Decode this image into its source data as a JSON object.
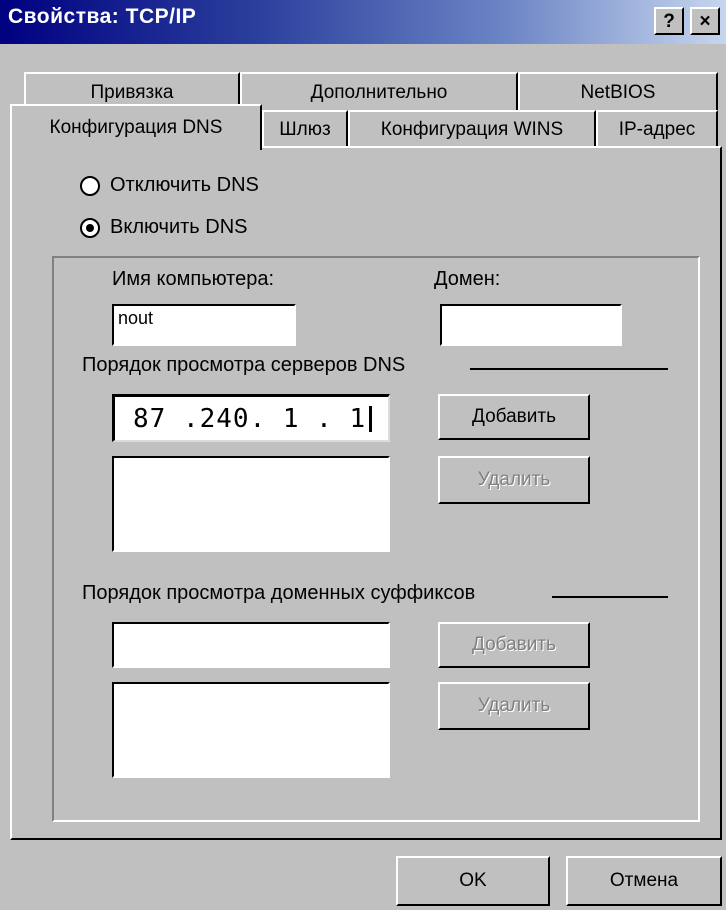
{
  "window": {
    "title": "Свойства: TCP/IP",
    "help_button": "?",
    "close_button": "×"
  },
  "tabs": {
    "row1": [
      "Привязка",
      "Дополнительно",
      "NetBIOS"
    ],
    "row2": [
      "Конфигурация DNS",
      "Шлюз",
      "Конфигурация WINS",
      "IP-адрес"
    ],
    "active": "Конфигурация DNS"
  },
  "dns": {
    "disable_label": "Отключить DNS",
    "enable_label": "Включить DNS",
    "selected": "enable",
    "hostname_label": "Имя компьютера:",
    "hostname_value": "nout",
    "domain_label": "Домен:",
    "domain_value": "",
    "server_order_label": "Порядок просмотра серверов DNS",
    "server_ip_value": "87 .240. 1 . 1",
    "add_server_button": "Добавить",
    "remove_server_button": "Удалить",
    "suffix_order_label": "Порядок просмотра доменных суффиксов",
    "suffix_input_value": "",
    "add_suffix_button": "Добавить",
    "remove_suffix_button": "Удалить"
  },
  "footer": {
    "ok_button": "OK",
    "cancel_button": "Отмена"
  },
  "colors": {
    "face": "#c0c0c0",
    "titlebar_start": "#000080",
    "titlebar_end": "#c7d6ee",
    "disabled_text": "#808080"
  }
}
